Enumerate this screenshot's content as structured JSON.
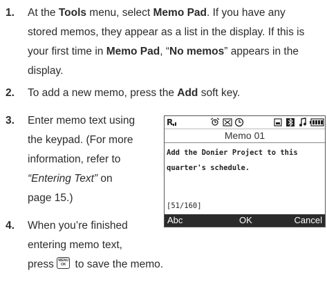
{
  "steps": [
    {
      "number": "1.",
      "lines": [
        [
          "At the ",
          {
            "b": "Tools"
          },
          " menu, select ",
          {
            "b": "Memo Pad"
          },
          ". If you have any"
        ],
        [
          "stored memos, they appear as a list in the display. If this is"
        ],
        [
          "your first time in ",
          {
            "b": "Memo Pad"
          },
          ", “",
          {
            "b": "No memos"
          },
          "” appears in the"
        ],
        [
          "display."
        ]
      ]
    },
    {
      "number": "2.",
      "lines": [
        [
          "To add a new memo, press the ",
          {
            "b": "Add"
          },
          " soft key."
        ]
      ]
    },
    {
      "number": "3.",
      "lines": [
        [
          "Enter memo text using"
        ],
        [
          "the keypad. (For more"
        ],
        [
          "information, refer to"
        ],
        [
          {
            "i": "“Entering Text”"
          },
          " on"
        ],
        [
          "page 15.)"
        ]
      ]
    },
    {
      "number": "4.",
      "lines": [
        [
          "When you’re finished"
        ],
        [
          "entering memo text,"
        ]
      ],
      "continuation": {
        "before": "press ",
        "after": " to save the memo."
      }
    }
  ],
  "phone_screen": {
    "title": "Memo 01",
    "memo_lines": [
      "Add the Donier Project to this",
      "quarter's schedule."
    ],
    "counter": "[51/160]",
    "softkeys": {
      "left": "Abc",
      "center": "OK",
      "right": "Cancel"
    }
  },
  "icons": [
    "signal-strength-icon",
    "alarm-icon",
    "message-icon",
    "clock-icon",
    "memory-card-icon",
    "bluetooth-icon",
    "music-icon",
    "battery-icon",
    "menu-ok-key-icon"
  ]
}
